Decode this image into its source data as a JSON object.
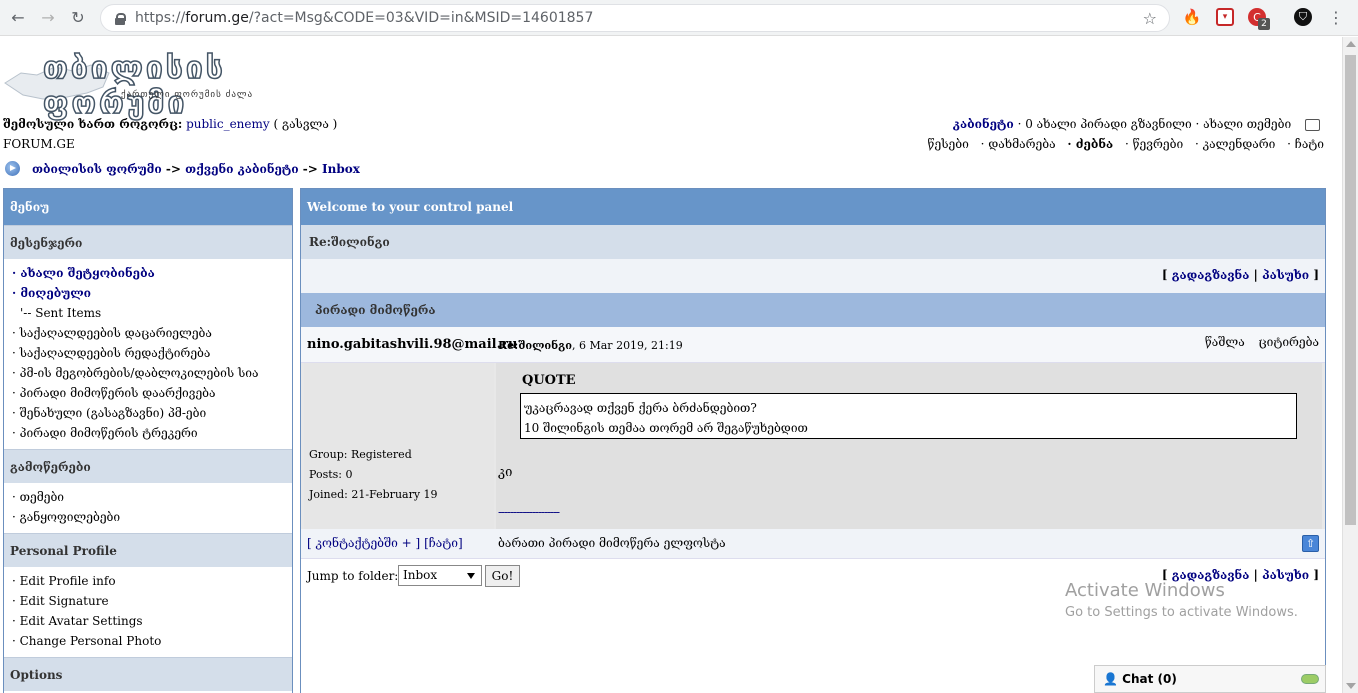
{
  "browser": {
    "url_prefix": "https://",
    "url_host": "forum.ge",
    "url_rest": "/?act=Msg&CODE=03&VID=in&MSID=14601857",
    "ext_badge": "2"
  },
  "header": {
    "logo_text": "თბილისის ფორუმი",
    "logo_sub": "ქართული ფორუმის ძალა",
    "logged_in_as": "შემოსული ხართ როგორც:",
    "username": "public_enemy",
    "logout": "( გასვლა )",
    "site": "FORUM.GE",
    "cabinet": "კაბინეტი",
    "new_pm": "· 0 ახალი პირადი გზავნილი · ახალი თემები",
    "menu": [
      "წესები",
      "· დახმარება",
      "· ძებნა",
      "· წევრები",
      "· კალენდარი",
      "· ჩატი"
    ]
  },
  "breadcrumb": {
    "forum": "თბილისის ფორუმი",
    "sep1": " -> ",
    "cabinet": "თქვენი კაბინეტი",
    "sep2": " -> ",
    "inbox": "Inbox"
  },
  "sidebar": {
    "title": "მენიუ",
    "messenger": {
      "title": "მესენჯერი",
      "items": [
        "· ახალი შეტყობინება",
        "· მიღებული",
        "'-- Sent Items",
        "· საქაღალდეების დაცარიელება",
        "· საქაღალდეების რედაქტირება",
        "· პმ-ის მეგობრების/დაბლოკილების სია",
        "· პირადი მიმოწერის დაარქივება",
        "· შენახული (გასაგზავნი) პმ-ები",
        "· პირადი მიმოწერის ტრეკერი"
      ]
    },
    "subscriptions": {
      "title": "გამოწერები",
      "items": [
        "· თემები",
        "· განყოფილებები"
      ]
    },
    "profile": {
      "title": "Personal Profile",
      "items": [
        "· Edit Profile info",
        "· Edit Signature",
        "· Edit Avatar Settings",
        "· Change Personal Photo"
      ]
    },
    "options": {
      "title": "Options"
    }
  },
  "main": {
    "title": "Welcome to your control panel",
    "subject": "Re:შილინგი",
    "forward": "გადაგზავნა",
    "reply": "პასუხი",
    "pm_header": "პირადი მიმოწერა",
    "message": {
      "author": "nino.gabitashvili.98@mail.ru",
      "subject": "Re:შილინგი",
      "date": ", 6 Mar 2019, 21:19",
      "delete": "წაშლა",
      "quote_action": "ციტირება",
      "group": "Group: Registered",
      "posts": "Posts: 0",
      "joined": "Joined: 21-February 19",
      "quote_label": "QUOTE",
      "quote_line1": "უკაცრავად თქვენ ქერა ბრძანდებით?",
      "quote_line2": "10 შილინგის თემაა თორემ არ შეგაწუხებდით",
      "body": "კი",
      "signature": "--------------------",
      "contacts": "[ კონტაქტებში + ]",
      "chat": "[ჩატი]",
      "footer_text": "ბარათი პირადი მიმოწერა ელფოსტა"
    },
    "jump_label": "Jump to folder:",
    "jump_value": "Inbox",
    "go": "Go!"
  },
  "watermark": {
    "line1": "Activate Windows",
    "line2": "Go to Settings to activate Windows."
  },
  "chat_widget": {
    "label": "Chat",
    "count": "(0)"
  }
}
